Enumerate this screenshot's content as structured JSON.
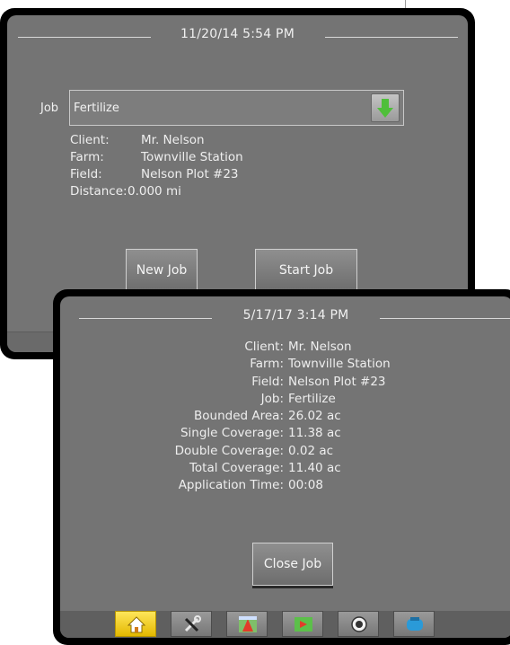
{
  "job_screen": {
    "datetime": "11/20/14 5:54 PM",
    "job_label": "Job",
    "job_value": "Fertilize",
    "dropdown_icon": "green-down-arrow-icon",
    "details": [
      {
        "label": "Client:",
        "value": "Mr. Nelson"
      },
      {
        "label": "Farm:",
        "value": "Townville Station"
      },
      {
        "label": "Field:",
        "value": "Nelson Plot #23"
      },
      {
        "label": "Distance:",
        "value": "0.000 mi"
      }
    ],
    "new_job_label": "New Job",
    "start_job_label": "Start Job"
  },
  "summary_screen": {
    "datetime": "5/17/17 3:14 PM",
    "rows": [
      {
        "label": "Client:",
        "value": "Mr. Nelson"
      },
      {
        "label": "Farm:",
        "value": "Townville Station"
      },
      {
        "label": "Field:",
        "value": "Nelson Plot #23"
      },
      {
        "label": "Job:",
        "value": "Fertilize"
      },
      {
        "label": "Bounded Area:",
        "value": "26.02 ac"
      },
      {
        "label": "Single Coverage:",
        "value": "11.38 ac"
      },
      {
        "label": "Double Coverage:",
        "value": "0.02 ac"
      },
      {
        "label": "Total Coverage:",
        "value": "11.40 ac"
      },
      {
        "label": "Application Time:",
        "value": "00:08"
      }
    ],
    "close_job_label": "Close Job"
  },
  "navbar": {
    "items": [
      {
        "icon": "home-icon",
        "active": true
      },
      {
        "icon": "tools-icon",
        "active": false
      },
      {
        "icon": "guidance-icon",
        "active": false
      },
      {
        "icon": "map-icon",
        "active": false
      },
      {
        "icon": "gauge-icon",
        "active": false
      },
      {
        "icon": "tank-icon",
        "active": false
      }
    ]
  },
  "colors": {
    "screen_bg": "#747474",
    "bezel": "#000000",
    "active_nav": "#f2cc1a",
    "dropdown_arrow": "#4fbf3a"
  }
}
